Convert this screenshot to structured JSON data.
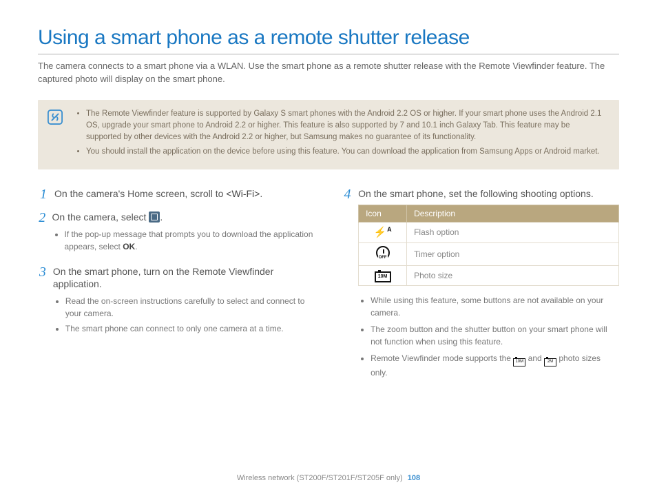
{
  "title": "Using a smart phone as a remote shutter release",
  "intro": "The camera connects to a smart phone via a WLAN. Use the smart phone as a remote shutter release with the Remote Viewfinder feature. The captured photo will display on the smart phone.",
  "note": {
    "items": [
      "The Remote Viewfinder feature is supported by Galaxy S smart phones with the Android 2.2 OS or higher. If your smart phone uses the Android 2.1 OS, upgrade your smart phone to Android 2.2 or higher. This feature is also supported by 7 and 10.1 inch Galaxy Tab. This feature may be supported by other devices with the Android 2.2 or higher, but Samsung makes no guarantee of its functionality.",
      "You should install the application on the device before using this feature. You can download the application from Samsung Apps or Android market."
    ]
  },
  "steps": {
    "s1_pre": "On the camera's Home screen, scroll to ",
    "s1_wifi": "<Wi-Fi>",
    "s1_post": ".",
    "s2_pre": "On the camera, select ",
    "s2_post": ".",
    "s2_sub_pre": "If the pop-up message that prompts you to download the application appears, select ",
    "s2_sub_bold": "OK",
    "s2_sub_post": ".",
    "s3": "On the smart phone, turn on the Remote Viewfinder application.",
    "s3_sub": [
      "Read the on-screen instructions carefully to select and connect to your camera.",
      "The smart phone can connect to only one camera at a time."
    ],
    "s4": "On the smart phone, set the following shooting options."
  },
  "table": {
    "h1": "Icon",
    "h2": "Description",
    "rows": [
      {
        "desc": "Flash option"
      },
      {
        "desc": "Timer option"
      },
      {
        "desc": "Photo size"
      }
    ]
  },
  "post": [
    "While using this feature, some buttons are not available on your camera.",
    "The zoom button and the shutter button on your smart phone will not function when using this feature."
  ],
  "post3_pre": "Remote Viewfinder mode supports the ",
  "post3_mid": " and ",
  "post3_post": " photo sizes only.",
  "footer": {
    "section": "Wireless network (ST200F/ST201F/ST205F only)",
    "page": "108"
  }
}
